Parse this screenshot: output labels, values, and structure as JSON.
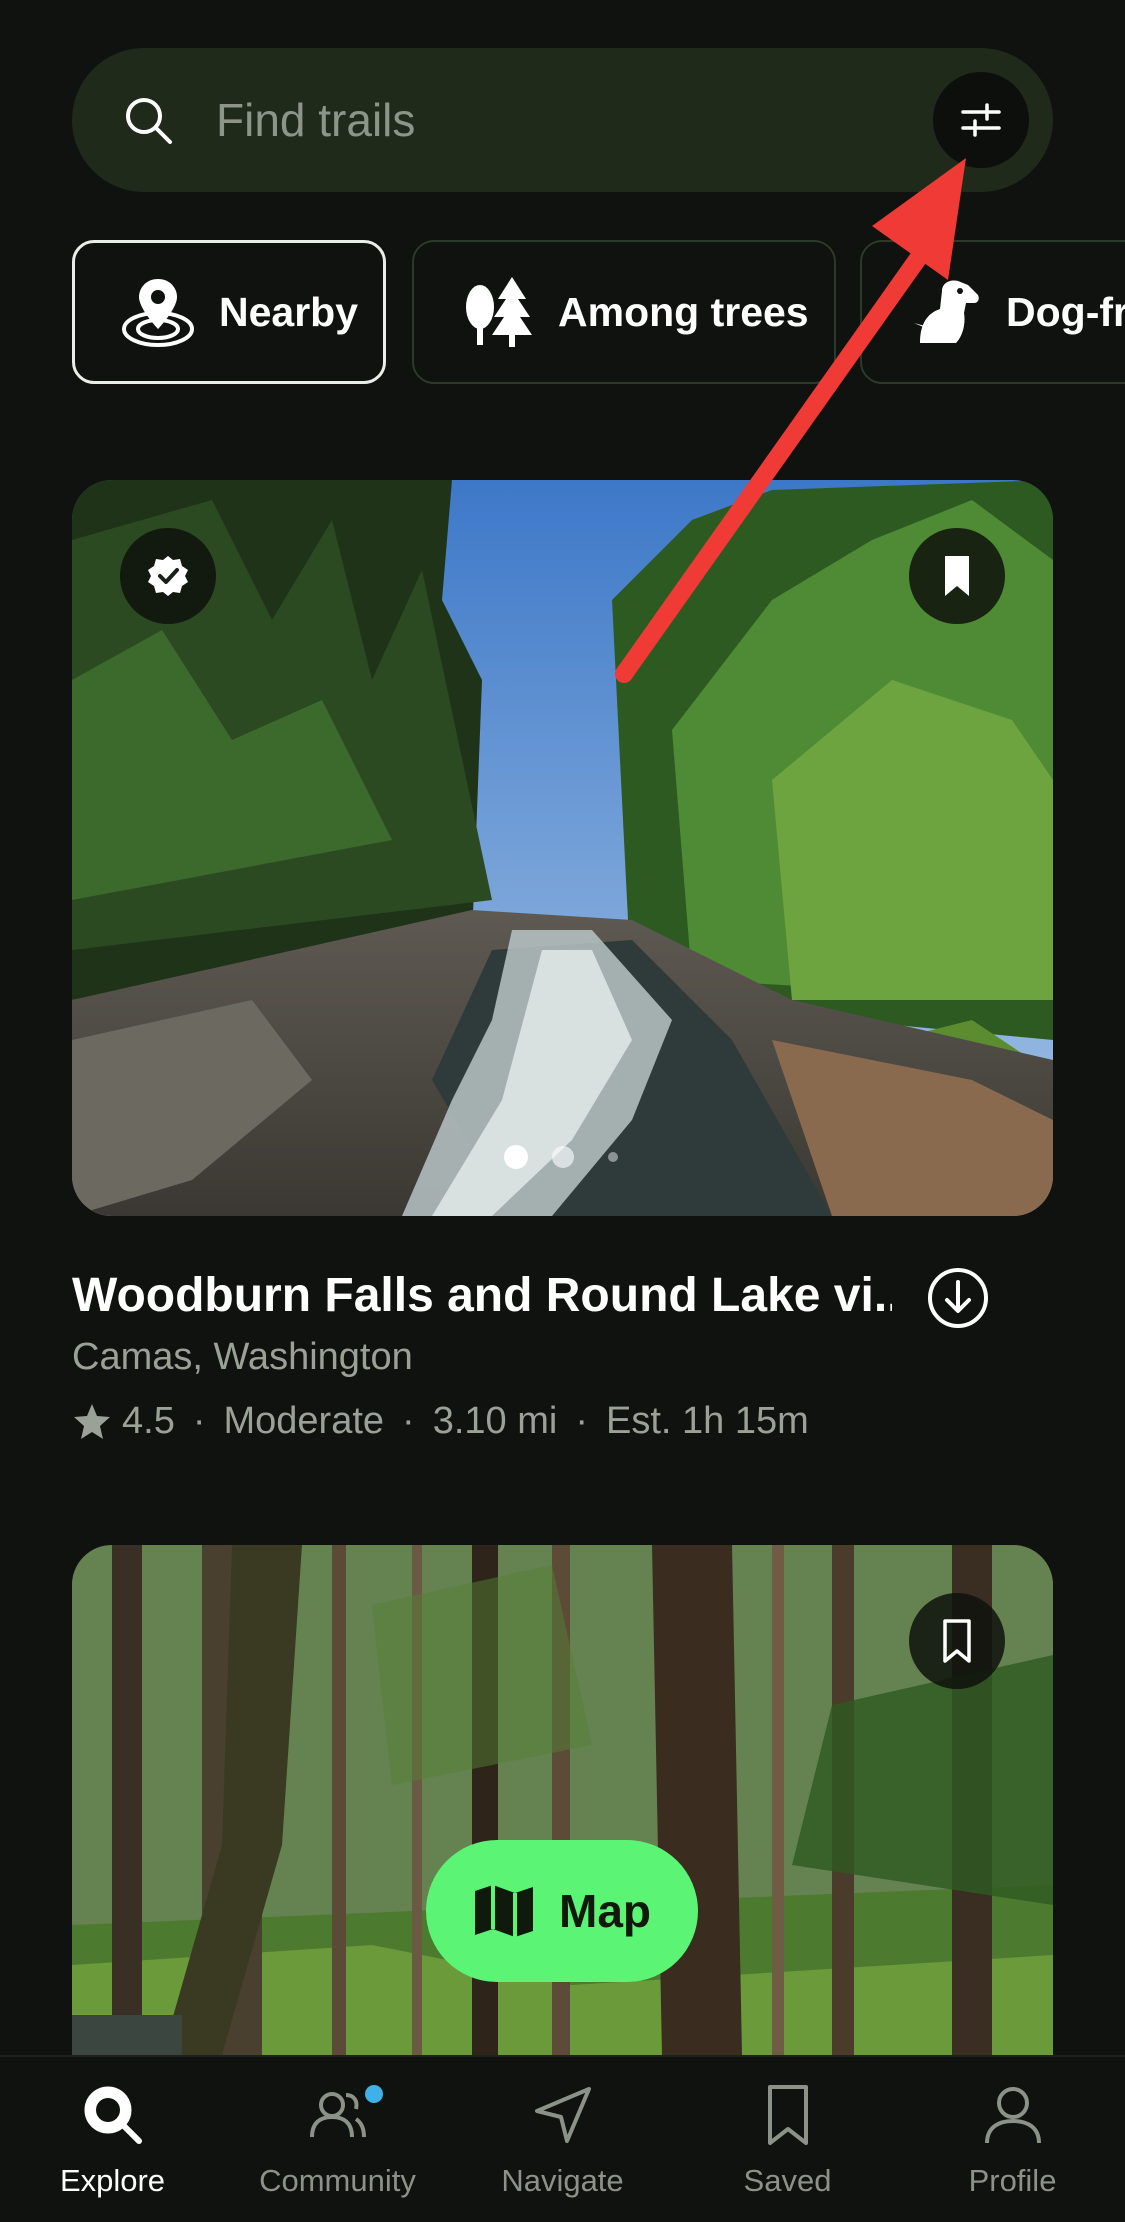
{
  "search": {
    "placeholder": "Find trails"
  },
  "chips": [
    {
      "label": "Nearby",
      "icon": "location-pin-icon",
      "active": true
    },
    {
      "label": "Among trees",
      "icon": "trees-icon",
      "active": false
    },
    {
      "label": "Dog-fr",
      "icon": "dog-icon",
      "active": false
    }
  ],
  "trails": [
    {
      "title": "Woodburn Falls and Round Lake vi...",
      "location": "Camas, Washington",
      "rating": "4.5",
      "difficulty": "Moderate",
      "distance": "3.10 mi",
      "estimate": "Est. 1h 15m",
      "separator": "·",
      "carousel_pages": 3,
      "carousel_current": 1
    }
  ],
  "map_button": {
    "label": "Map"
  },
  "nav": [
    {
      "label": "Explore",
      "icon": "search-icon",
      "active": true
    },
    {
      "label": "Community",
      "icon": "community-icon",
      "active": false
    },
    {
      "label": "Navigate",
      "icon": "navigate-icon",
      "active": false
    },
    {
      "label": "Saved",
      "icon": "bookmark-icon",
      "active": false
    },
    {
      "label": "Profile",
      "icon": "profile-icon",
      "active": false
    }
  ],
  "colors": {
    "background": "#0f120e",
    "search_bg": "#1f2a1b",
    "accent_green": "#5cf475",
    "annotation_red": "#f03a35",
    "notification": "#3fb0e8"
  }
}
